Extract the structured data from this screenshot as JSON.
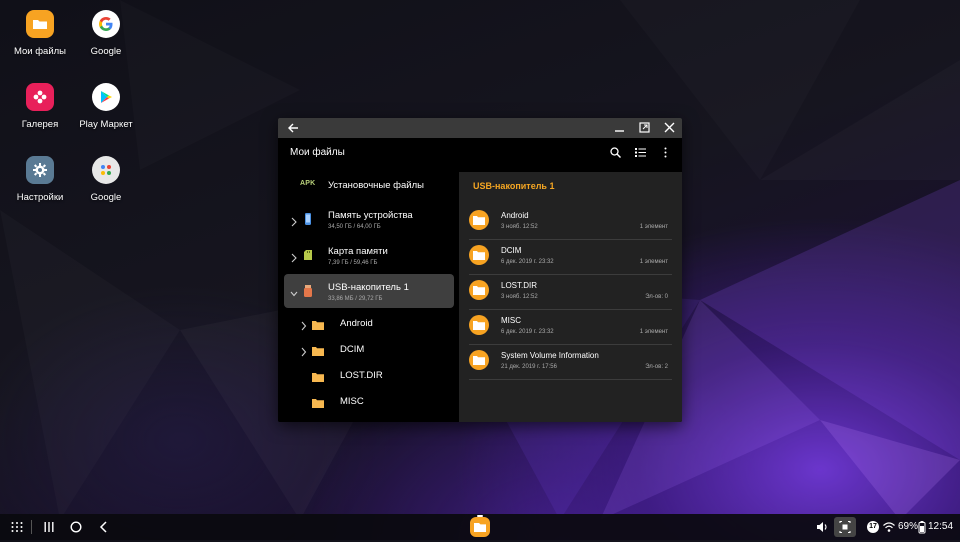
{
  "desktop": {
    "icons": [
      {
        "label": "Мои файлы",
        "icon": "folder-icon",
        "color": "#f7a322"
      },
      {
        "label": "Google",
        "icon": "google-icon",
        "color": "#ffffff"
      },
      {
        "label": "Галерея",
        "icon": "flower-icon",
        "color": "#e8205a"
      },
      {
        "label": "Play Маркет",
        "icon": "play-store-icon",
        "color": "#ffffff"
      },
      {
        "label": "Настройки",
        "icon": "gear-icon",
        "color": "#5a7a94"
      },
      {
        "label": "Google",
        "icon": "google-folder-icon",
        "color": "#e8e8e8"
      }
    ]
  },
  "window": {
    "app_title": "Мои файлы",
    "sidebar": {
      "apk_badge": "APK",
      "installers_label": "Установочные файлы",
      "storages": [
        {
          "name": "Память устройства",
          "usage": "34,50 ГБ / 64,00 ГБ",
          "icon": "phone-icon"
        },
        {
          "name": "Карта памяти",
          "usage": "7,39 ГБ / 59,46 ГБ",
          "icon": "sd-card-icon"
        },
        {
          "name": "USB-накопитель 1",
          "usage": "33,86 МБ / 29,72 ГБ",
          "icon": "usb-icon"
        }
      ],
      "subfolders": [
        {
          "name": "Android",
          "expandable": true
        },
        {
          "name": "DCIM",
          "expandable": true
        },
        {
          "name": "LOST.DIR",
          "expandable": false
        },
        {
          "name": "MISC",
          "expandable": false
        }
      ]
    },
    "content": {
      "path_title": "USB-накопитель 1",
      "files": [
        {
          "name": "Android",
          "date": "3 нояб. 12:52",
          "count": "1 элемент"
        },
        {
          "name": "DCIM",
          "date": "6 дек. 2019 г. 23:32",
          "count": "1 элемент"
        },
        {
          "name": "LOST.DIR",
          "date": "3 нояб. 12:52",
          "count": "Эл-ов: 0"
        },
        {
          "name": "MISC",
          "date": "6 дек. 2019 г. 23:32",
          "count": "1 элемент"
        },
        {
          "name": "System Volume Information",
          "date": "21 дек. 2019 г. 17:56",
          "count": "Эл-ов: 2"
        }
      ]
    }
  },
  "taskbar": {
    "notification_count": "17",
    "battery": "69%",
    "time": "12:54"
  },
  "colors": {
    "accent": "#f5a623",
    "folder": "#f7a322",
    "window_bg": "#000000",
    "content_bg": "#222222",
    "titlebar_bg": "#3a3a3a"
  }
}
